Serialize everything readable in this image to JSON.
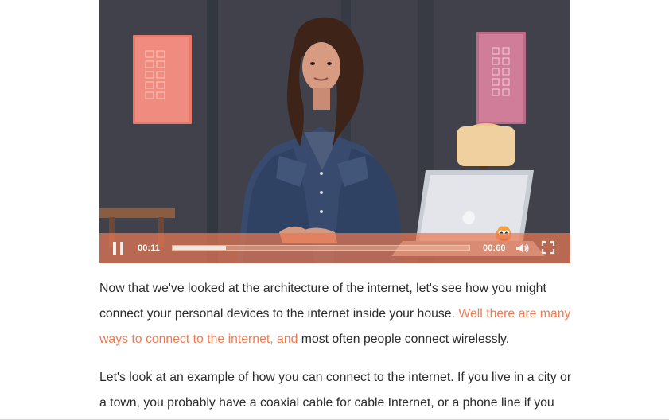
{
  "video": {
    "current_time": "00:11",
    "duration": "00:60",
    "progress_fraction": 0.18,
    "controls_color": "#e87854",
    "accent_color": "#f07b51"
  },
  "article": {
    "paragraph_1_part_1": "Now that we've looked at the architecture of the internet, let's see how you might connect your personal devices to the internet inside your house. ",
    "paragraph_1_highlight": "Well there are many ways to connect to the internet, and",
    "paragraph_1_part_2": " most often people connect wirelessly.",
    "paragraph_2_part_1": "Let's look at an example of how you can connect to the internet. If you live in a city or a town, you probably have a coaxial cable for cable Internet, or a phone line if you"
  },
  "icons": {
    "pause": "pause-icon",
    "volume": "volume-icon",
    "fullscreen": "fullscreen-icon",
    "caption": "caption-icon"
  }
}
